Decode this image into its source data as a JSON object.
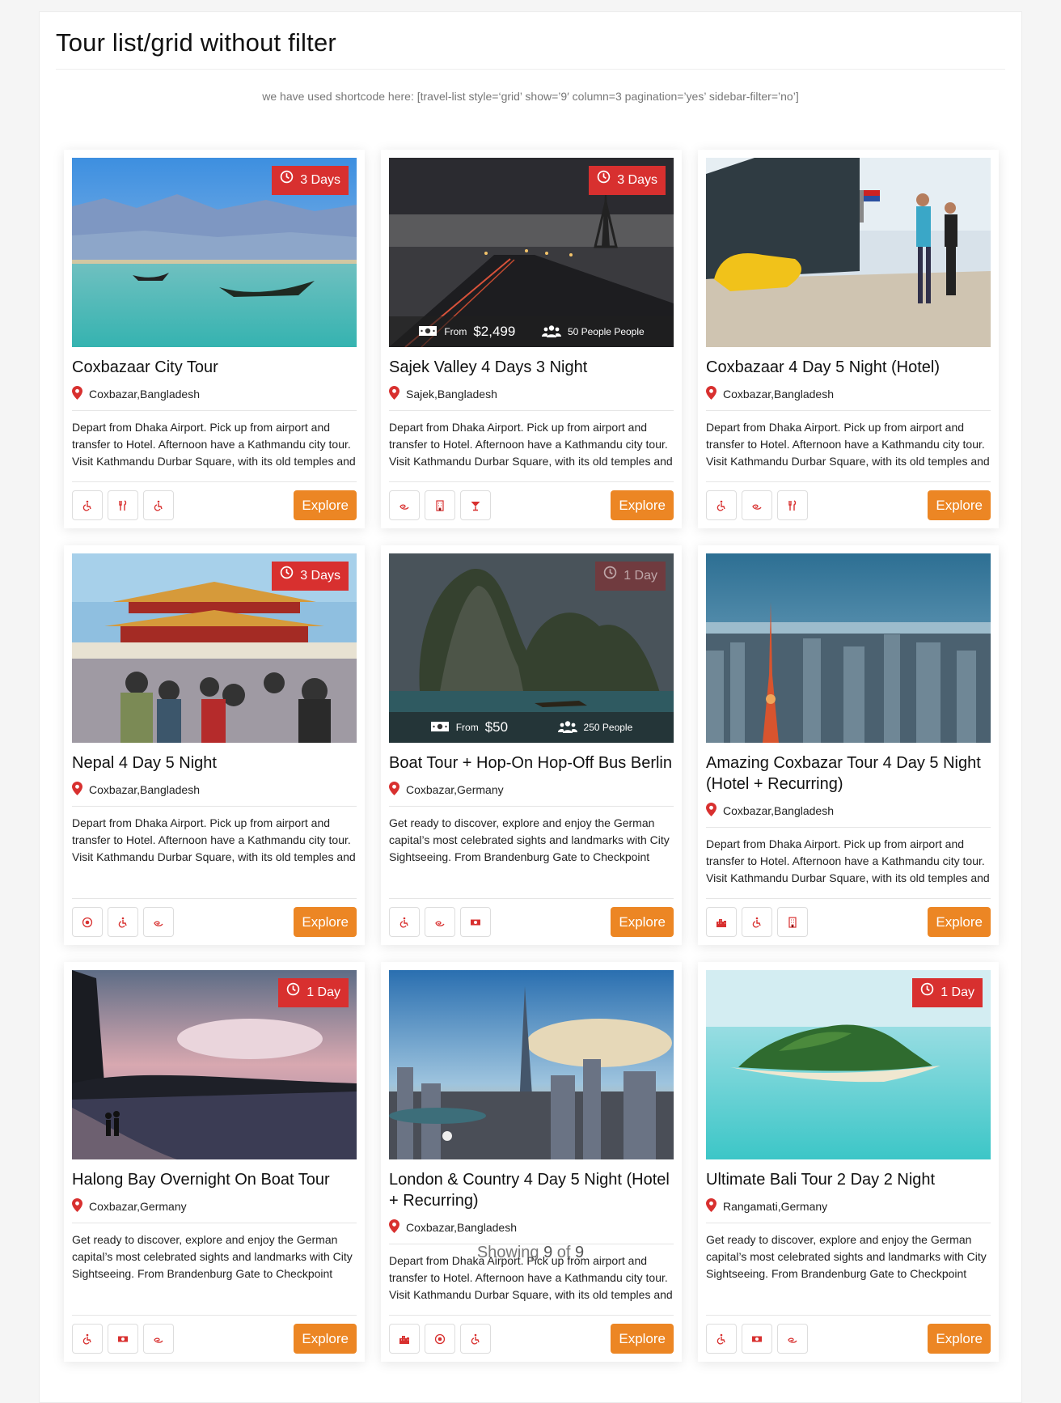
{
  "page": {
    "title": "Tour list/grid without filter",
    "note": "we have used shortcode here: [travel-list style=‘grid’ show=’9′ column=3 pagination=’yes’ sidebar-filter=’no’]",
    "showing_prefix": "Showing",
    "showing_count": "9",
    "showing_of": "of",
    "showing_total": "9"
  },
  "colors": {
    "accent_red": "#d8302f",
    "explore_orange": "#ec8624"
  },
  "tours": [
    {
      "title": "Coxbazaar City Tour",
      "location": "Coxbazar,Bangladesh",
      "duration": "3 Days",
      "description": "Depart from Dhaka Airport. Pick up from airport and transfer to Hotel. Afternoon have a Kathmandu city tour. Visit Kathmandu Durbar Square, with its old temples and",
      "explore": "Explore",
      "icons": [
        "wheelchair-icon",
        "fork-knife-icon",
        "wheelchair-icon"
      ],
      "scene": "lake"
    },
    {
      "title": "Sajek Valley 4 Days 3 Night",
      "location": "Sajek,Bangladesh",
      "duration": "3 Days",
      "price_prefix": "From",
      "price": "$2,499",
      "people": "50 People People",
      "description": "Depart from Dhaka Airport. Pick up from airport and transfer to Hotel. Afternoon have a Kathmandu city tour. Visit Kathmandu Durbar Square, with its old temples and",
      "explore": "Explore",
      "icons": [
        "swirl-icon",
        "building-icon",
        "cocktail-icon"
      ],
      "scene": "paris"
    },
    {
      "title": "Coxbazaar 4 Day 5 Night (Hotel)",
      "location": "Coxbazar,Bangladesh",
      "description": "Depart from Dhaka Airport. Pick up from airport and transfer to Hotel. Afternoon have a Kathmandu city tour. Visit Kathmandu Durbar Square, with its old temples and",
      "explore": "Explore",
      "icons": [
        "wheelchair-icon",
        "swirl-icon",
        "fork-knife-icon"
      ],
      "scene": "clog"
    },
    {
      "title": "Nepal 4 Day 5 Night",
      "location": "Coxbazar,Bangladesh",
      "duration": "3 Days",
      "description": "Depart from Dhaka Airport. Pick up from airport and transfer to Hotel. Afternoon have a Kathmandu city tour. Visit Kathmandu Durbar Square, with its old temples and",
      "explore": "Explore",
      "icons": [
        "play-circle-icon",
        "wheelchair-icon",
        "swirl-icon"
      ],
      "scene": "palace"
    },
    {
      "title": "Boat Tour + Hop-On Hop-Off Bus Berlin",
      "location": "Coxbazar,Germany",
      "duration": "1 Day",
      "price_prefix": "From",
      "price": "$50",
      "people": "250 People",
      "description": "Get ready to discover, explore and enjoy the German capital’s most celebrated sights and landmarks with City Sightseeing. From Brandenburg Gate to Checkpoint",
      "explore": "Explore",
      "icons": [
        "wheelchair-icon",
        "swirl-icon",
        "money-icon"
      ],
      "scene": "rock"
    },
    {
      "title": "Amazing Coxbazar Tour 4 Day 5 Night (Hotel + Recurring)",
      "location": "Coxbazar,Bangladesh",
      "description": "Depart from Dhaka Airport. Pick up from airport and transfer to Hotel. Afternoon have a Kathmandu city tour. Visit Kathmandu Durbar Square, with its old temples and",
      "explore": "Explore",
      "icons": [
        "city-icon",
        "wheelchair-icon",
        "building-icon"
      ],
      "scene": "tokyo"
    },
    {
      "title": "Halong Bay Overnight On Boat Tour",
      "location": "Coxbazar,Germany",
      "duration": "1 Day",
      "description": "Get ready to discover, explore and enjoy the German capital’s most celebrated sights and landmarks with City Sightseeing. From Brandenburg Gate to Checkpoint",
      "explore": "Explore",
      "icons": [
        "wheelchair-icon",
        "money-icon",
        "swirl-icon"
      ],
      "scene": "beach"
    },
    {
      "title": "London & Country 4 Day 5 Night (Hotel + Recurring)",
      "location": "Coxbazar,Bangladesh",
      "description": "Depart from Dhaka Airport. Pick up from airport and transfer to Hotel. Afternoon have a Kathmandu city tour. Visit Kathmandu Durbar Square, with its old temples and",
      "explore": "Explore",
      "icons": [
        "city-icon",
        "play-circle-icon",
        "wheelchair-icon"
      ],
      "scene": "tower"
    },
    {
      "title": "Ultimate Bali Tour 2 Day 2 Night",
      "location": "Rangamati,Germany",
      "duration": "1 Day",
      "description": "Get ready to discover, explore and enjoy the German capital’s most celebrated sights and landmarks with City Sightseeing. From Brandenburg Gate to Checkpoint",
      "explore": "Explore",
      "icons": [
        "wheelchair-icon",
        "money-icon",
        "swirl-icon"
      ],
      "scene": "island"
    }
  ]
}
